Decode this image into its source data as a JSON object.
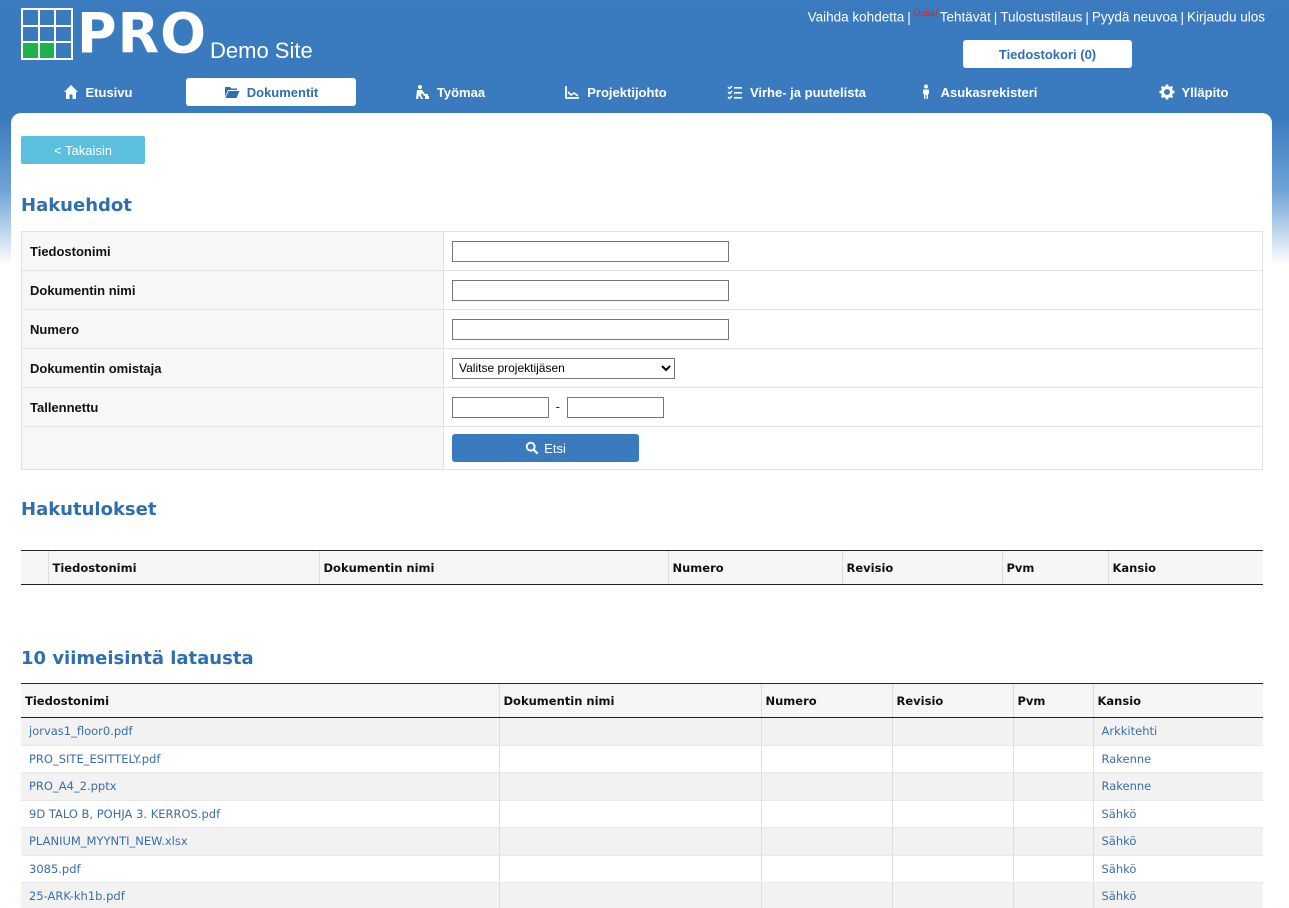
{
  "header": {
    "logo_text": "PRO",
    "site_name": "Demo Site",
    "toplinks": {
      "switch_site": "Vaihda kohdetta",
      "new_badge": "Uutta!",
      "tasks": "Tehtävät",
      "print_order": "Tulostustilaus",
      "ask_help": "Pyydä neuvoa",
      "logout": "Kirjaudu ulos"
    },
    "file_basket": "Tiedostokori (0)"
  },
  "nav": {
    "home": "Etusivu",
    "documents": "Dokumentit",
    "worksite": "Työmaa",
    "project_mgmt": "Projektijohto",
    "defects": "Virhe- ja puutelista",
    "residents": "Asukasrekisteri",
    "admin": "Ylläpito"
  },
  "back_button": "< Takaisin",
  "search": {
    "heading": "Hakuehdot",
    "filename_label": "Tiedostonimi",
    "docname_label": "Dokumentin nimi",
    "number_label": "Numero",
    "owner_label": "Dokumentin omistaja",
    "owner_selected": "Valitse projektijäsen",
    "saved_label": "Tallennettu",
    "date_separator": "-",
    "search_button": "Etsi"
  },
  "results": {
    "heading": "Hakutulokset",
    "columns": [
      "",
      "Tiedostonimi",
      "Dokumentin nimi",
      "Numero",
      "Revisio",
      "Pvm",
      "Kansio"
    ]
  },
  "recent": {
    "heading": "10 viimeisintä latausta",
    "columns": [
      "Tiedostonimi",
      "Dokumentin nimi",
      "Numero",
      "Revisio",
      "Pvm",
      "Kansio"
    ],
    "rows": [
      {
        "file": "jorvas1_floor0.pdf",
        "folder": "Arkkitehti"
      },
      {
        "file": "PRO_SITE_ESITTELY.pdf",
        "folder": "Rakenne"
      },
      {
        "file": "PRO_A4_2.pptx",
        "folder": "Rakenne"
      },
      {
        "file": "9D TALO B, POHJA 3. KERROS.pdf",
        "folder": "Sähkö"
      },
      {
        "file": "PLANIUM_MYYNTI_NEW.xlsx",
        "folder": "Sähkö"
      },
      {
        "file": "3085.pdf",
        "folder": "Sähkö"
      },
      {
        "file": "25-ARK-kh1b.pdf",
        "folder": "Sähkö"
      }
    ]
  }
}
